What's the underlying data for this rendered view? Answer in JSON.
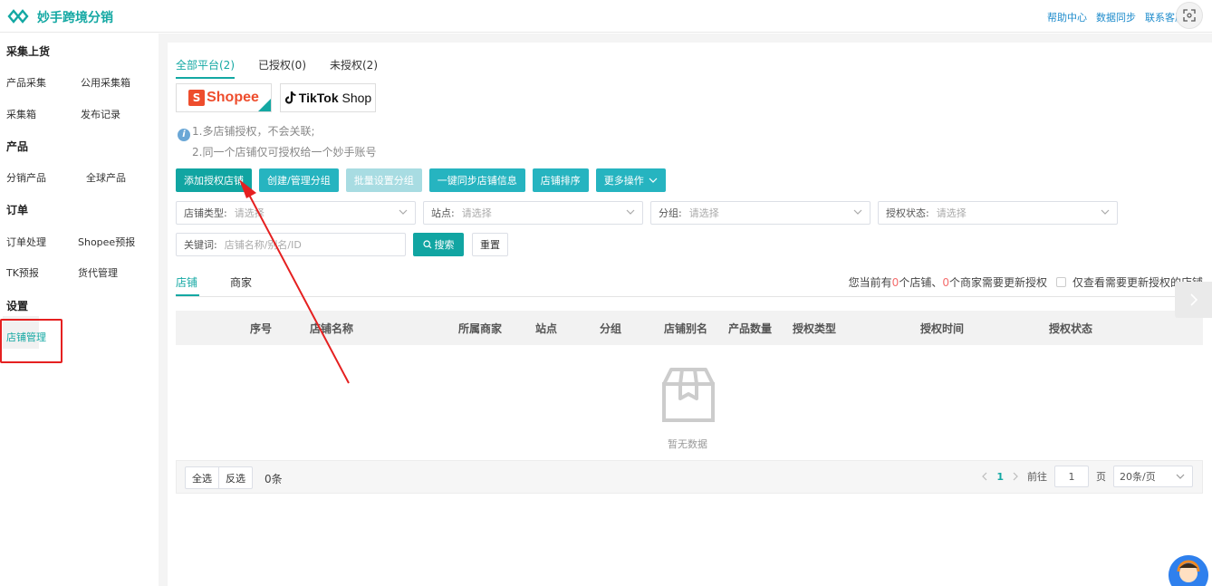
{
  "header": {
    "brand": "妙手跨境分销",
    "links": [
      "帮助中心",
      "数据同步",
      "联系客服"
    ],
    "colors": {
      "brand": "#13a8a3",
      "link": "#1f8ccc"
    }
  },
  "sidebar": {
    "sections": [
      {
        "title": "采集上货",
        "items": [
          "产品采集",
          "公用采集箱",
          "采集箱",
          "发布记录"
        ]
      },
      {
        "title": "产品",
        "items": [
          "分销产品",
          "全球产品"
        ]
      },
      {
        "title": "订单",
        "items": [
          "订单处理",
          "Shopee预报",
          "TK预报",
          "货代管理"
        ]
      },
      {
        "title": "设置",
        "items": [
          "店铺管理"
        ]
      }
    ],
    "active_item": "店铺管理",
    "active_color": "#13a8a3"
  },
  "platform_tabs": [
    {
      "label": "全部平台(2)",
      "active": true
    },
    {
      "label": "已授权(0)",
      "active": false
    },
    {
      "label": "未授权(2)",
      "active": false
    }
  ],
  "platforms": {
    "shopee": {
      "logo_text": "Shopee",
      "icon": "shopping-bag-icon",
      "selected": true
    },
    "tiktok": {
      "logo_text_bold": "TikTok",
      "logo_text_light": " Shop",
      "icon": "tiktok-icon"
    }
  },
  "notes": [
    "1.多店铺授权，不会关联;",
    "2.同一个店铺仅可授权给一个妙手账号"
  ],
  "actions": [
    {
      "label": "添加授权店铺",
      "state": "primary"
    },
    {
      "label": "创建/管理分组",
      "state": "normal"
    },
    {
      "label": "批量设置分组",
      "state": "disabled"
    },
    {
      "label": "一键同步店铺信息",
      "state": "normal"
    },
    {
      "label": "店铺排序",
      "state": "normal"
    },
    {
      "label": "更多操作",
      "state": "normal"
    }
  ],
  "filters": {
    "shop_type": {
      "label": "店铺类型:",
      "placeholder": "请选择"
    },
    "site": {
      "label": "站点:",
      "placeholder": "请选择"
    },
    "group": {
      "label": "分组:",
      "placeholder": "请选择"
    },
    "auth_status": {
      "label": "授权状态:",
      "placeholder": "请选择"
    },
    "keyword": {
      "label": "关键词:",
      "placeholder": "店铺名称/别名/ID"
    },
    "search_label": "搜索",
    "reset_label": "重置"
  },
  "subtabs": [
    {
      "label": "店铺",
      "active": true
    },
    {
      "label": "商家",
      "active": false
    }
  ],
  "update_info": {
    "prefix": "您当前有",
    "shop_count": "0",
    "middle": "个店铺、",
    "merchant_count": "0",
    "suffix": "个商家需要更新授权",
    "checkbox_label": "仅查看需要更新授权的店铺"
  },
  "table": {
    "columns": [
      "序号",
      "店铺名称",
      "所属商家",
      "站点",
      "分组",
      "店铺别名",
      "产品数量",
      "授权类型",
      "授权时间",
      "授权状态"
    ],
    "rows": [],
    "empty_text": "暂无数据"
  },
  "footer": {
    "select_all": "全选",
    "invert": "反选",
    "count": "0条",
    "current_page": "1",
    "goto_label": "前往",
    "page_input": "1",
    "page_unit": "页",
    "page_size": "20条/页"
  }
}
